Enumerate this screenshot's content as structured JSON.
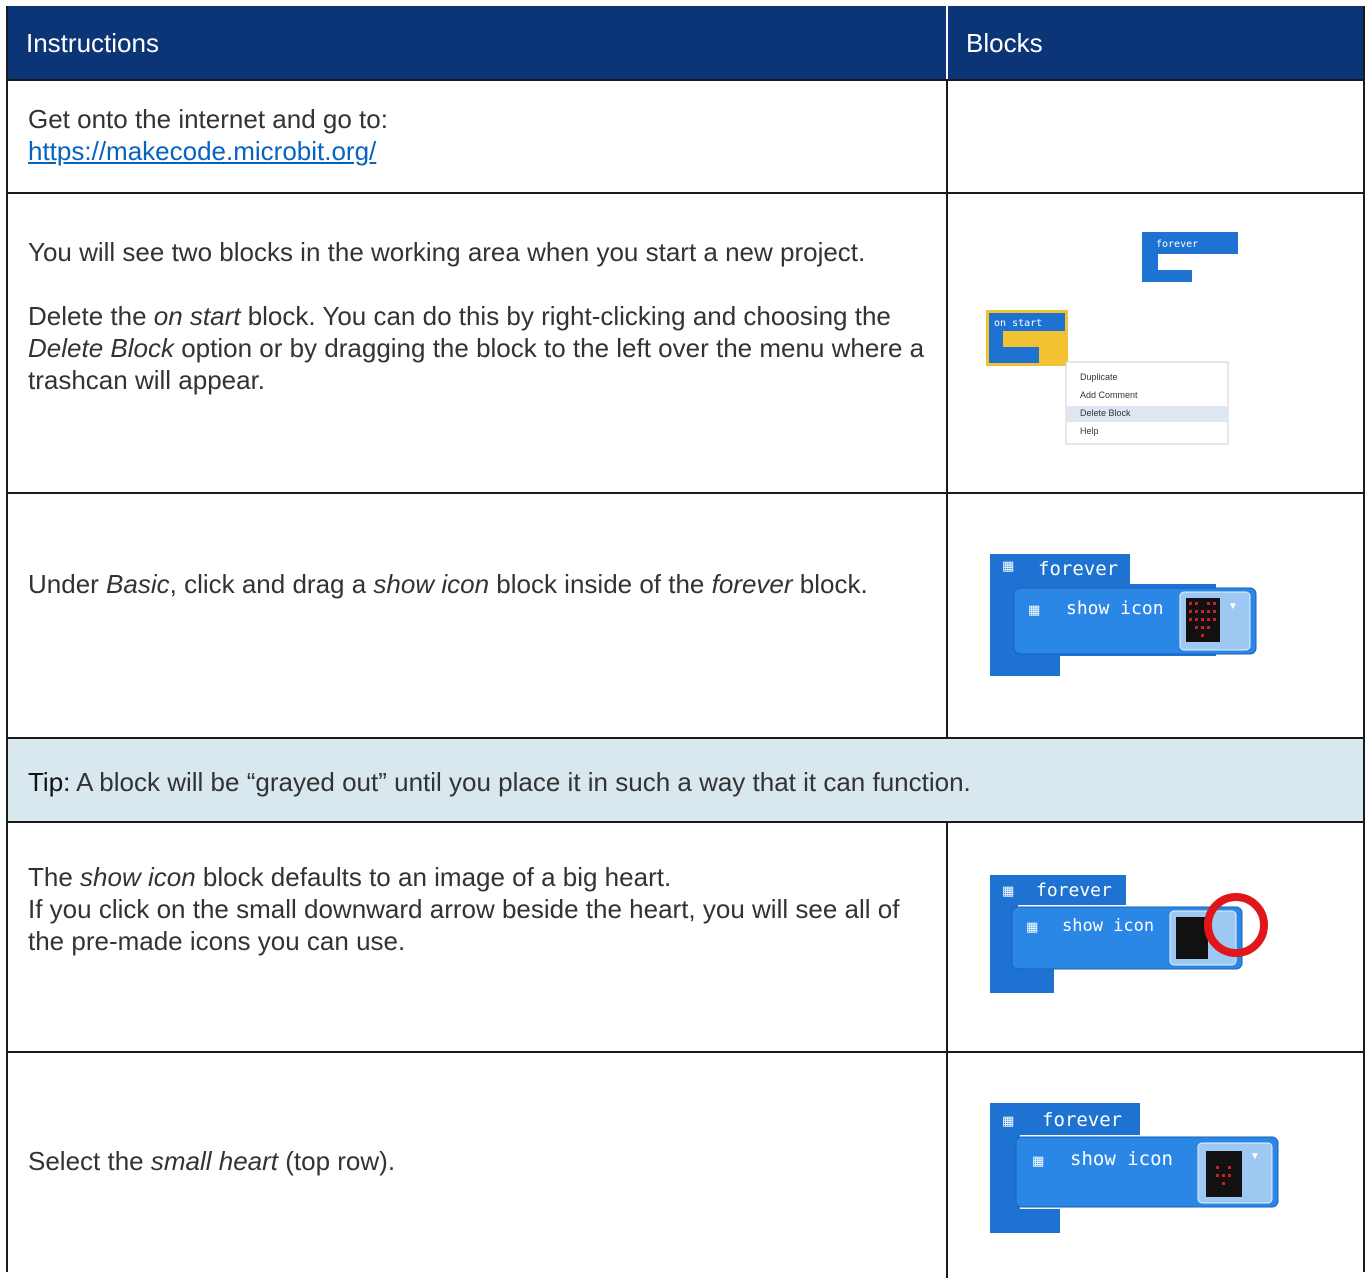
{
  "header": {
    "col1": "Instructions",
    "col2": "Blocks"
  },
  "rows": [
    {
      "text1": "Get onto the internet and go to:",
      "link": "https://makecode.microbit.org/"
    },
    {
      "p1": "You will see two blocks in the working area when you start a new project.",
      "p2a": "Delete the ",
      "p2b": "on start",
      "p2c": " block. You can do this by right-clicking and choosing the ",
      "p2d": "Delete Block",
      "p2e": " option or by dragging the block to the left over the menu where a trashcan will appear.",
      "image": {
        "forever_label": "forever",
        "onstart_label": "on start",
        "menu": [
          "Duplicate",
          "Add Comment",
          "Delete Block",
          "Help"
        ]
      }
    },
    {
      "a": "Under ",
      "b": "Basic",
      "c": ", click and drag a ",
      "d": "show icon",
      "e": " block inside of the ",
      "f": "forever",
      "g": " block.",
      "image": {
        "forever_label": "forever",
        "show_label": "show icon"
      }
    },
    {
      "tip_label": "Tip:",
      "tip_text": " A block will be “grayed out” until you place it in such a way that it can function."
    },
    {
      "a": "The ",
      "b": "show icon",
      "c": " block defaults to an image of a big heart.",
      "d": "If you click on the small downward arrow beside the heart, you will see all of the pre-made icons you can use.",
      "image": {
        "forever_label": "forever",
        "show_label": "show icon"
      }
    },
    {
      "a": "Select the ",
      "b": "small heart",
      "c": " (top row).",
      "image": {
        "forever_label": "forever",
        "show_label": "show icon"
      }
    }
  ],
  "colors": {
    "header_bg": "#0b3576",
    "tip_bg": "#d8e8ee",
    "block_blue": "#1e73d2",
    "link": "#0563c1",
    "highlight_ring": "#e0161b"
  }
}
